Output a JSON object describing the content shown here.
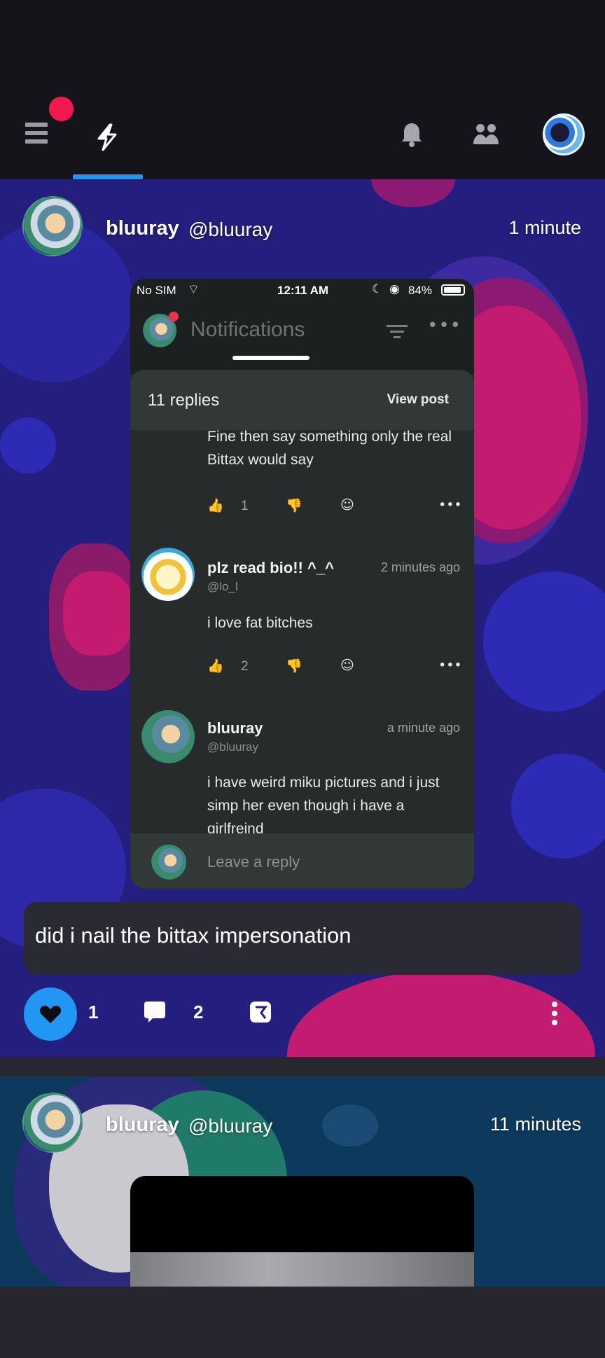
{
  "nav": {
    "items": [
      "menu",
      "featured",
      "notifications",
      "friends",
      "profile"
    ],
    "accent_color": "#2196f3",
    "badge_color": "#f2194e"
  },
  "post1": {
    "display_name": "bluuray",
    "handle": "@bluuray",
    "time": "1 minute",
    "caption": "did i nail the bittax impersonation",
    "likes": "1",
    "comments": "2",
    "screenshot": {
      "status": {
        "carrier": "No SIM",
        "time": "12:11 AM",
        "battery": "84%"
      },
      "header_title": "Notifications",
      "replies_count": "11 replies",
      "view_post": "View post",
      "comments": [
        {
          "text": "Fine then say something only the real Bittax would say",
          "likes": "1"
        },
        {
          "name": "plz read bio!! ^_^",
          "handle": "@lo_l",
          "time": "2 minutes ago",
          "text": "i love fat bitches",
          "likes": "2"
        },
        {
          "name": "bluuray",
          "handle": "@bluuray",
          "time": "a minute ago",
          "text": "i have weird miku pictures and i just simp her even though i have a girlfreind"
        }
      ],
      "reply_placeholder": "Leave a reply"
    }
  },
  "post2": {
    "display_name": "bluuray",
    "handle": "@bluuray",
    "time": "11 minutes"
  }
}
